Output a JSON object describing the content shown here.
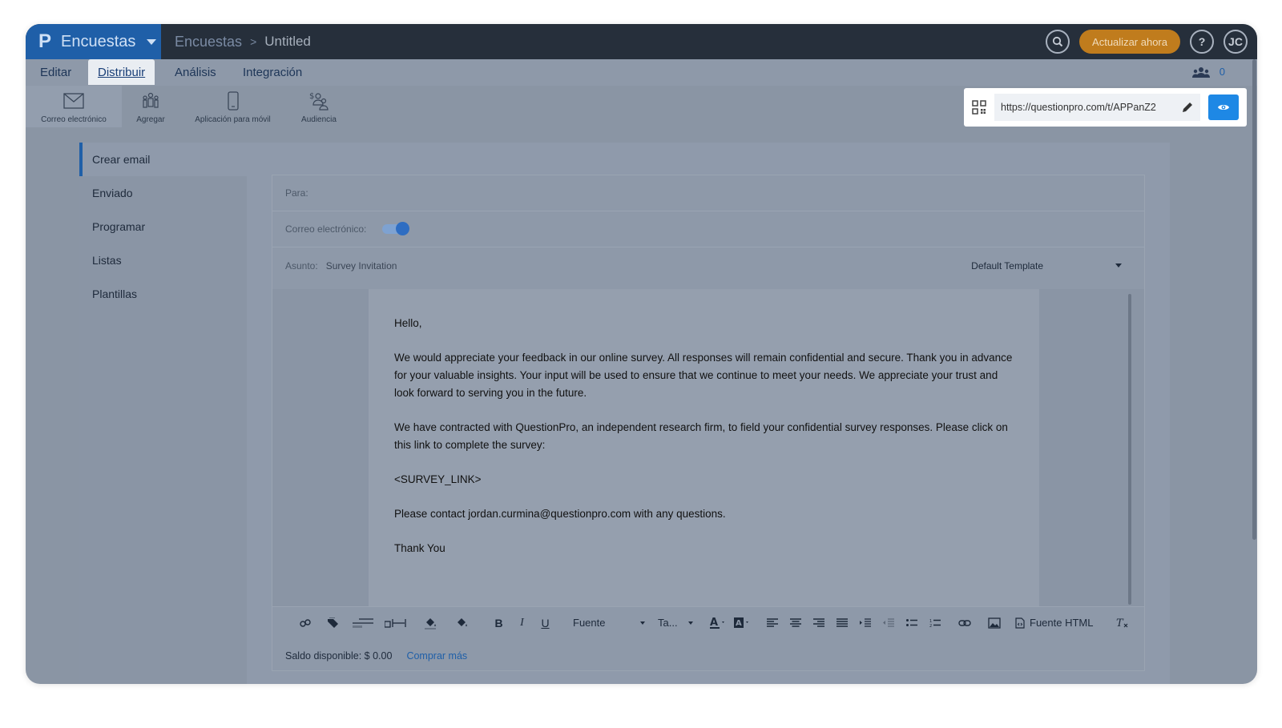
{
  "topbar": {
    "brand_logo": "P",
    "brand_name": "Encuestas",
    "breadcrumb_root": "Encuestas",
    "breadcrumb_sep": ">",
    "breadcrumb_current": "Untitled",
    "upgrade_label": "Actualizar ahora",
    "help_label": "?",
    "avatar_initials": "JC"
  },
  "tabs": [
    {
      "label": "Editar"
    },
    {
      "label": "Distribuir"
    },
    {
      "label": "Análisis"
    },
    {
      "label": "Integración"
    }
  ],
  "users_count": "0",
  "tools": [
    {
      "label": "Correo electrónico",
      "icon": "envelope-icon"
    },
    {
      "label": "Agregar",
      "icon": "people-icon"
    },
    {
      "label": "Aplicación para móvil",
      "icon": "mobile-icon"
    },
    {
      "label": "Audiencia",
      "icon": "audience-icon"
    }
  ],
  "survey_url": "https://questionpro.com/t/APPanZ2",
  "sidebar": [
    {
      "label": "Crear email"
    },
    {
      "label": "Enviado"
    },
    {
      "label": "Programar"
    },
    {
      "label": "Listas"
    },
    {
      "label": "Plantillas"
    }
  ],
  "form": {
    "to_label": "Para:",
    "email_toggle_label": "Correo electrónico:",
    "email_toggle_on": true,
    "subject_label": "Asunto:",
    "subject_value": "Survey Invitation",
    "template_value": "Default Template"
  },
  "email_body": {
    "greeting": "Hello,",
    "p1": "We would appreciate your feedback in our online survey. All responses will remain confidential and secure. Thank you in advance for your valuable insights. Your input will be used to ensure that we continue to meet your needs. We appreciate your trust and look forward to serving you in the future.",
    "p2": "We have contracted with QuestionPro, an independent research firm, to field your confidential survey responses. Please click on this link to complete the survey:",
    "link_token": "<SURVEY_LINK>",
    "p3": "Please contact jordan.curmina@questionpro.com with any questions.",
    "closing": "Thank You"
  },
  "editor_toolbar": {
    "bold": "B",
    "italic": "I",
    "underline": "U",
    "font_label": "Fuente",
    "size_label": "Ta...",
    "html_source_label": "Fuente HTML"
  },
  "footer": {
    "balance": "Saldo disponible: $ 0.00",
    "buy_more": "Comprar más"
  },
  "colors": {
    "brand": "#1f5fa8",
    "upgrade": "#c07c1d",
    "preview_button": "#1e88e5"
  }
}
